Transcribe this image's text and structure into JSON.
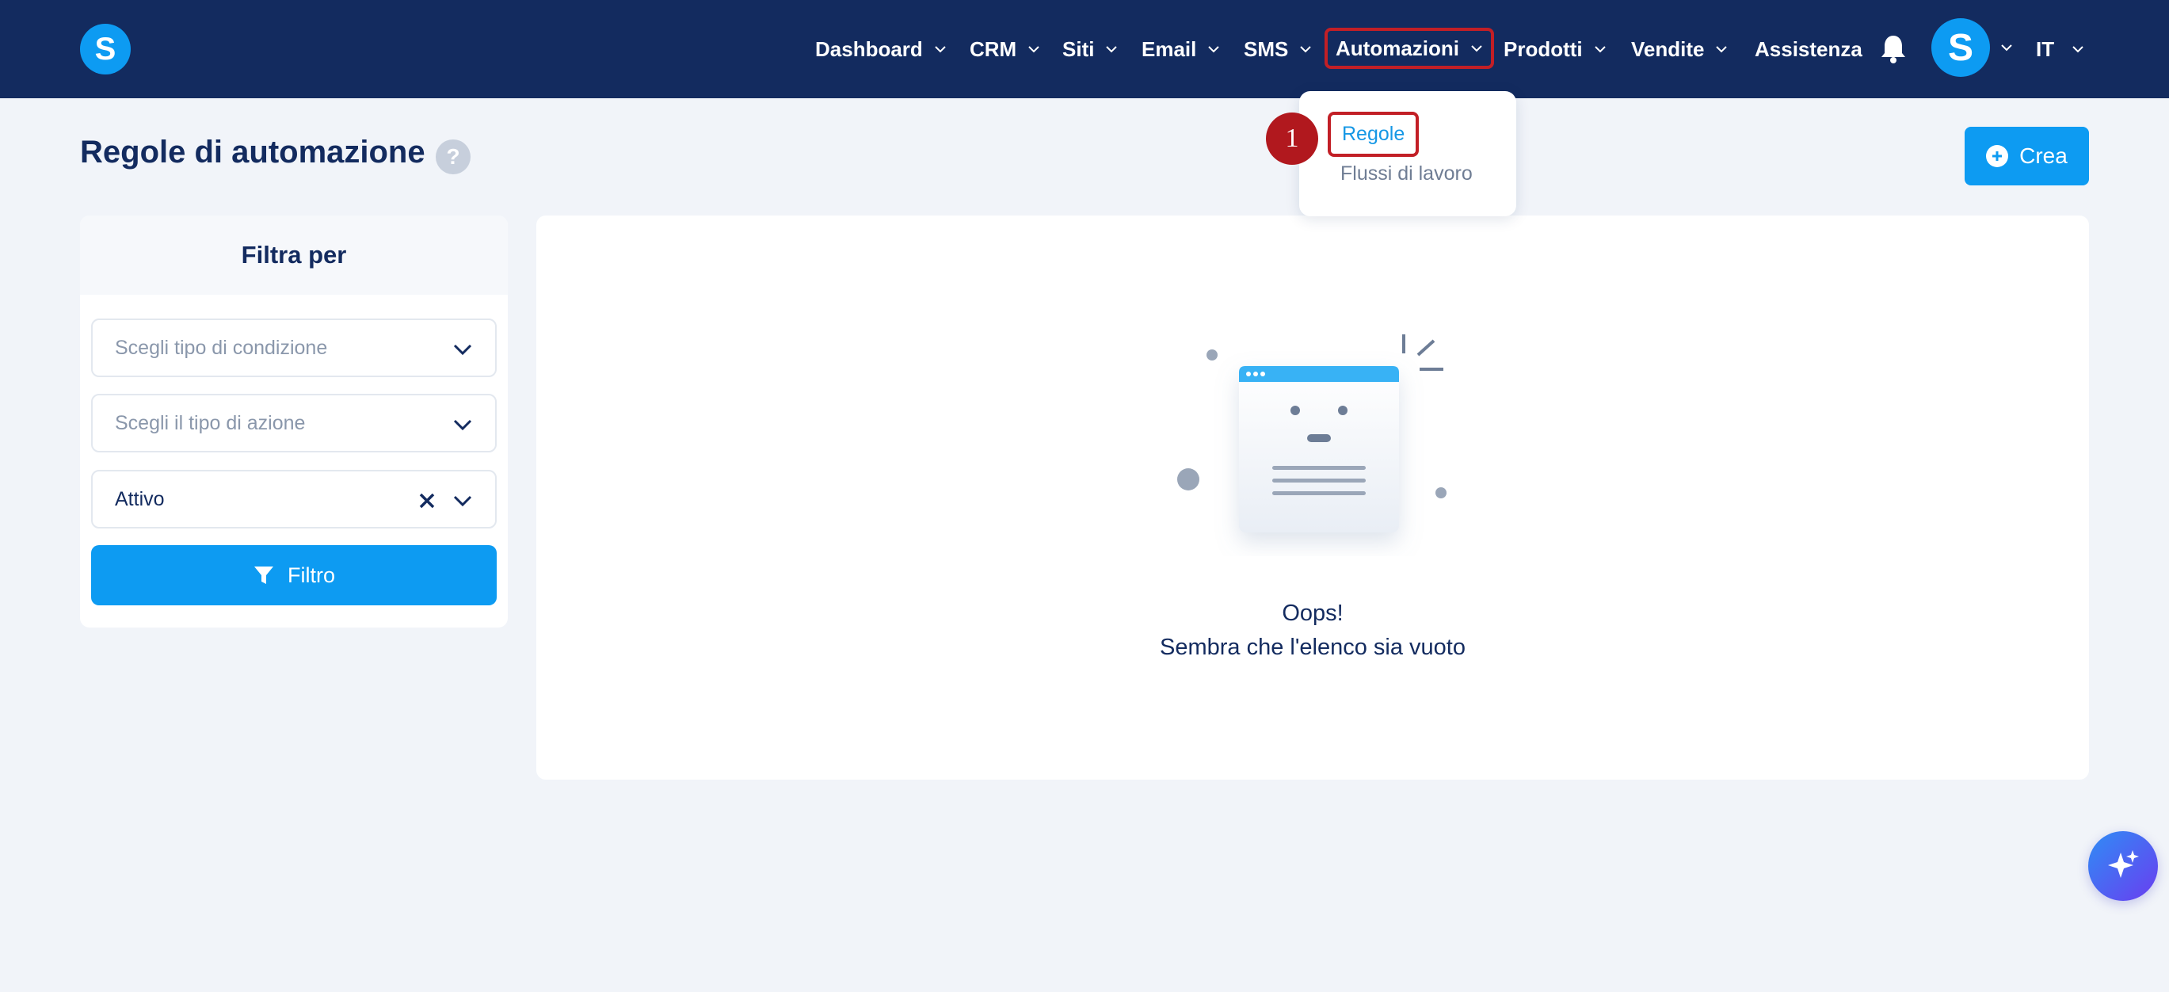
{
  "nav": {
    "items": [
      {
        "label": "Dashboard",
        "has_chevron": true
      },
      {
        "label": "CRM",
        "has_chevron": true
      },
      {
        "label": "Siti",
        "has_chevron": true
      },
      {
        "label": "Email",
        "has_chevron": true
      },
      {
        "label": "SMS",
        "has_chevron": true
      },
      {
        "label": "Automazioni",
        "has_chevron": true,
        "active": true
      },
      {
        "label": "Prodotti",
        "has_chevron": true
      },
      {
        "label": "Vendite",
        "has_chevron": true
      },
      {
        "label": "Assistenza",
        "has_chevron": false
      }
    ],
    "logo_letter": "S",
    "avatar_letter": "S",
    "language": "IT"
  },
  "dropdown": {
    "items": [
      "Regole",
      "Flussi di lavoro"
    ],
    "step_badge": "1"
  },
  "page": {
    "title": "Regole di automazione",
    "help": "?",
    "create_label": "Crea"
  },
  "filter": {
    "heading": "Filtra per",
    "condition_placeholder": "Scegli tipo di condizione",
    "action_placeholder": "Scegli il tipo di azione",
    "status_value": "Attivo",
    "button_label": "Filtro"
  },
  "empty_state": {
    "line1": "Oops!",
    "line2": "Sembra che l'elenco sia vuoto"
  },
  "colors": {
    "navbar": "#132b5f",
    "accent": "#0d9bf2",
    "highlight": "#c21f26"
  }
}
